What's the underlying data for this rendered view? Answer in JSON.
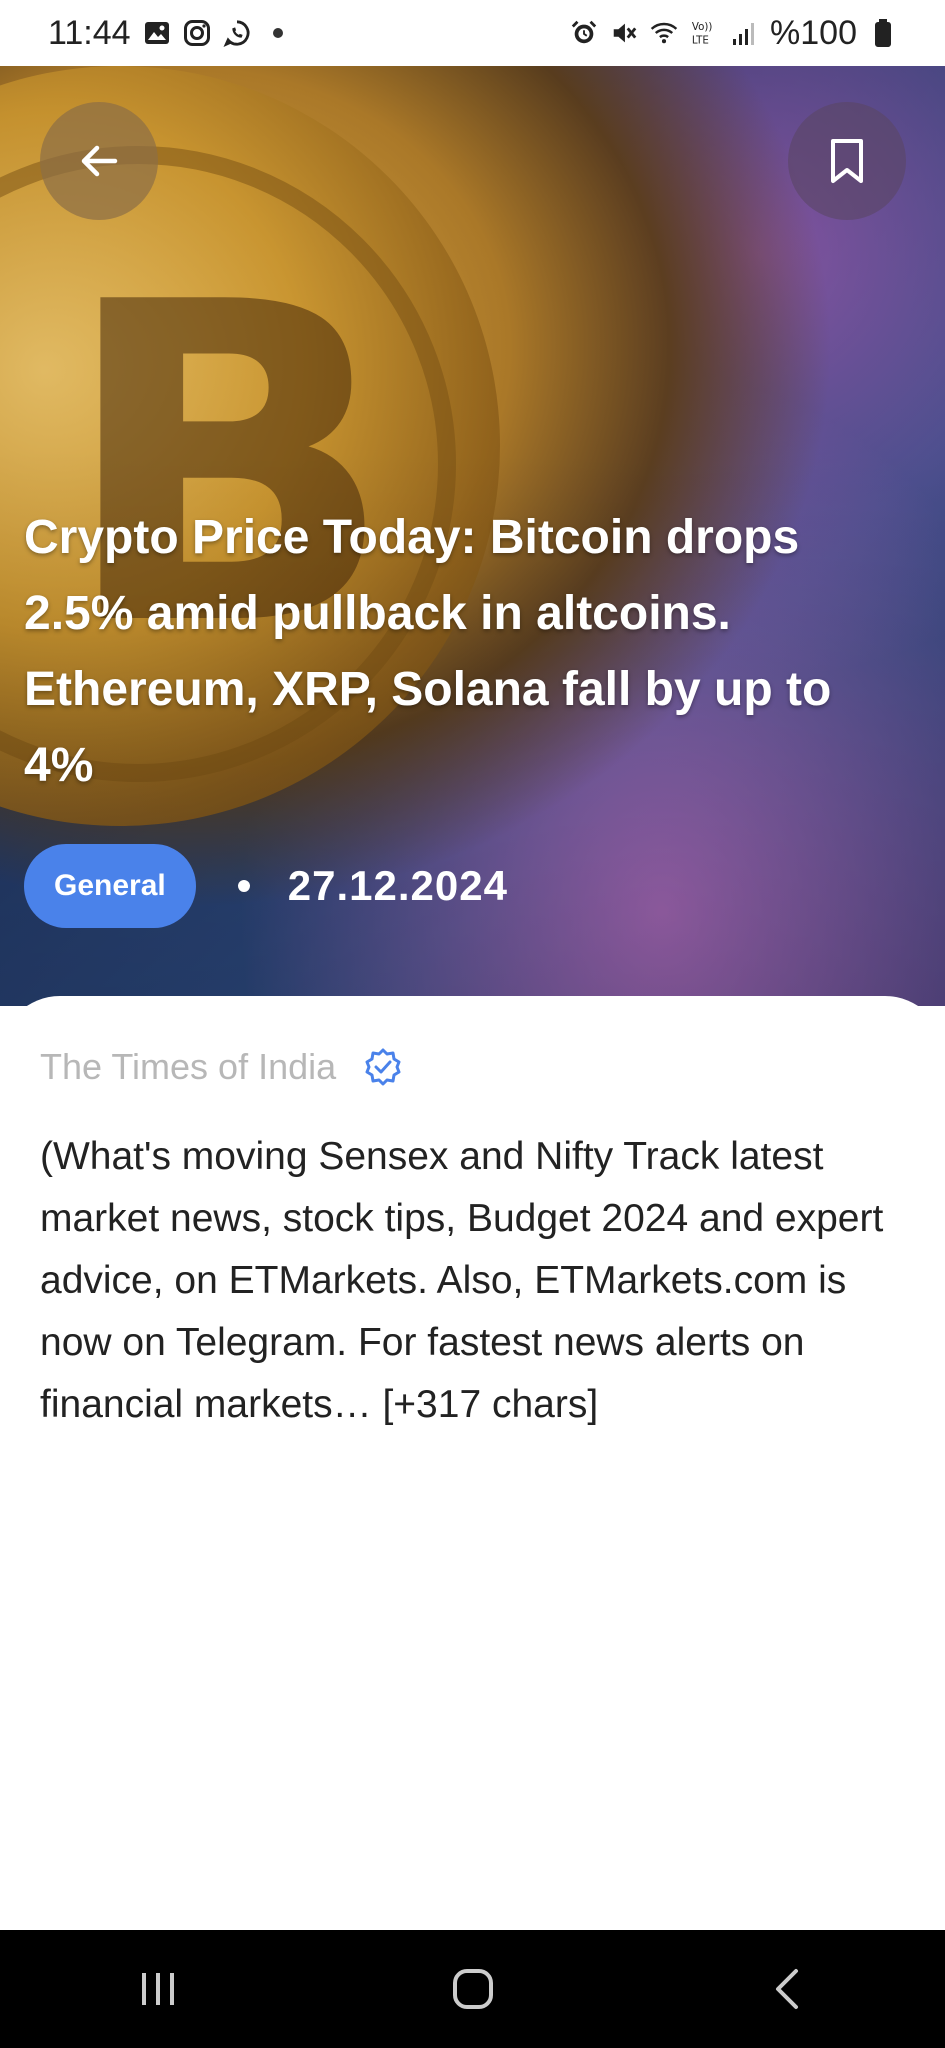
{
  "status_bar": {
    "time": "11:44",
    "battery_text": "%100",
    "left_icons": [
      "gallery-icon",
      "instagram-icon",
      "whatsapp-icon",
      "notification-dot"
    ],
    "right_icons": [
      "alarm-icon",
      "mute-icon",
      "wifi-icon",
      "volte-icon",
      "signal-icon",
      "battery-icon"
    ]
  },
  "article": {
    "title": "Crypto Price Today: Bitcoin drops 2.5% amid pullback in altcoins. Ethereum, XRP, Solana fall by up to 4%",
    "category": "General",
    "date": "27.12.2024",
    "source": "The Times of India",
    "source_verified": true,
    "description": "(What's moving Sensex and Nifty Track latest market news, stock tips, Budget 2024 and expert advice, on ETMarkets. Also, ETMarkets.com is now on Telegram. For fastest news alerts on financial markets… [+317 chars]"
  },
  "colors": {
    "chip": "#4a82ea",
    "verified_badge": "#4a82ea",
    "source_text": "#b7b7b7",
    "nav_bar": "#000000"
  },
  "buttons": {
    "back_icon": "arrow-left-icon",
    "bookmark_icon": "bookmark-icon"
  },
  "nav": {
    "recents_icon": "recents-icon",
    "home_icon": "home-icon",
    "back_icon": "back-chevron-icon"
  }
}
